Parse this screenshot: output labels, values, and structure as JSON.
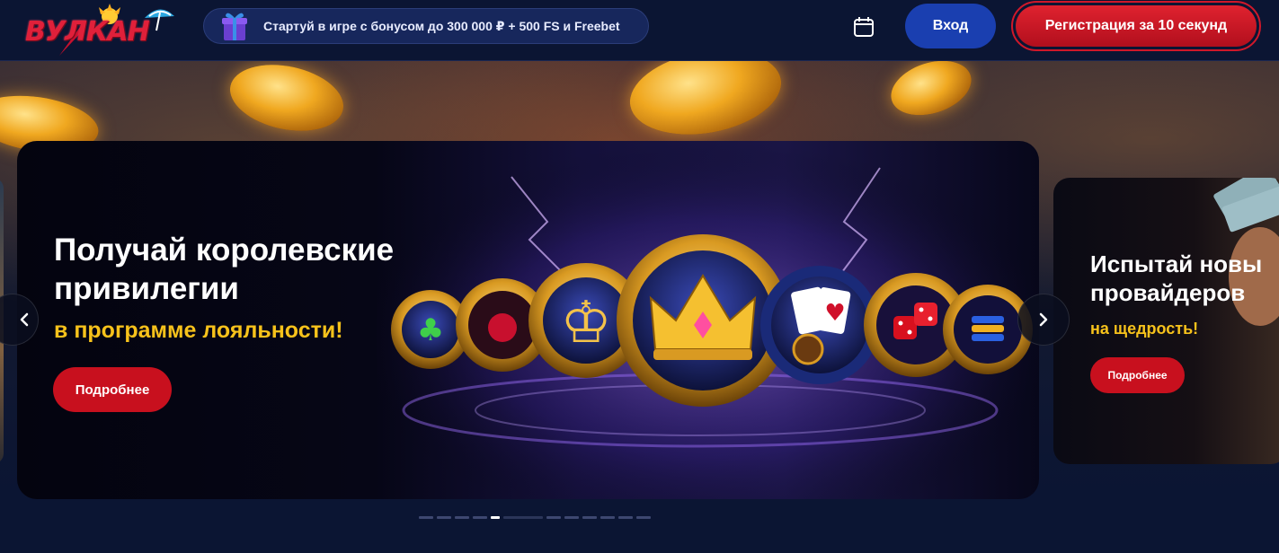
{
  "header": {
    "logo_text": "ВУЛКАН",
    "promo_text": "Стартуй в игре с бонусом до 300 000 ₽ + 500 FS и Freebet",
    "login_label": "Вход",
    "register_label": "Регистрация за 10 секунд",
    "colors": {
      "background": "#0b1533",
      "login": "#1a3fb0",
      "register": "#d0182a"
    }
  },
  "carousel": {
    "main_slide": {
      "title": "Получай королевские привилегии",
      "subtitle": "в программе лояльности!",
      "button_label": "Подробнее"
    },
    "next_slide": {
      "title_line1": "Испытай новы",
      "title_line2": "провайдеров",
      "subtitle": "на щедрость!",
      "button_label": "Подробнее"
    },
    "prev_icon": "chevron-left-icon",
    "next_icon": "chevron-right-icon",
    "dots_count": 13,
    "active_dot": 5,
    "accent": "#f7c21b",
    "button_color": "#c8101e"
  }
}
